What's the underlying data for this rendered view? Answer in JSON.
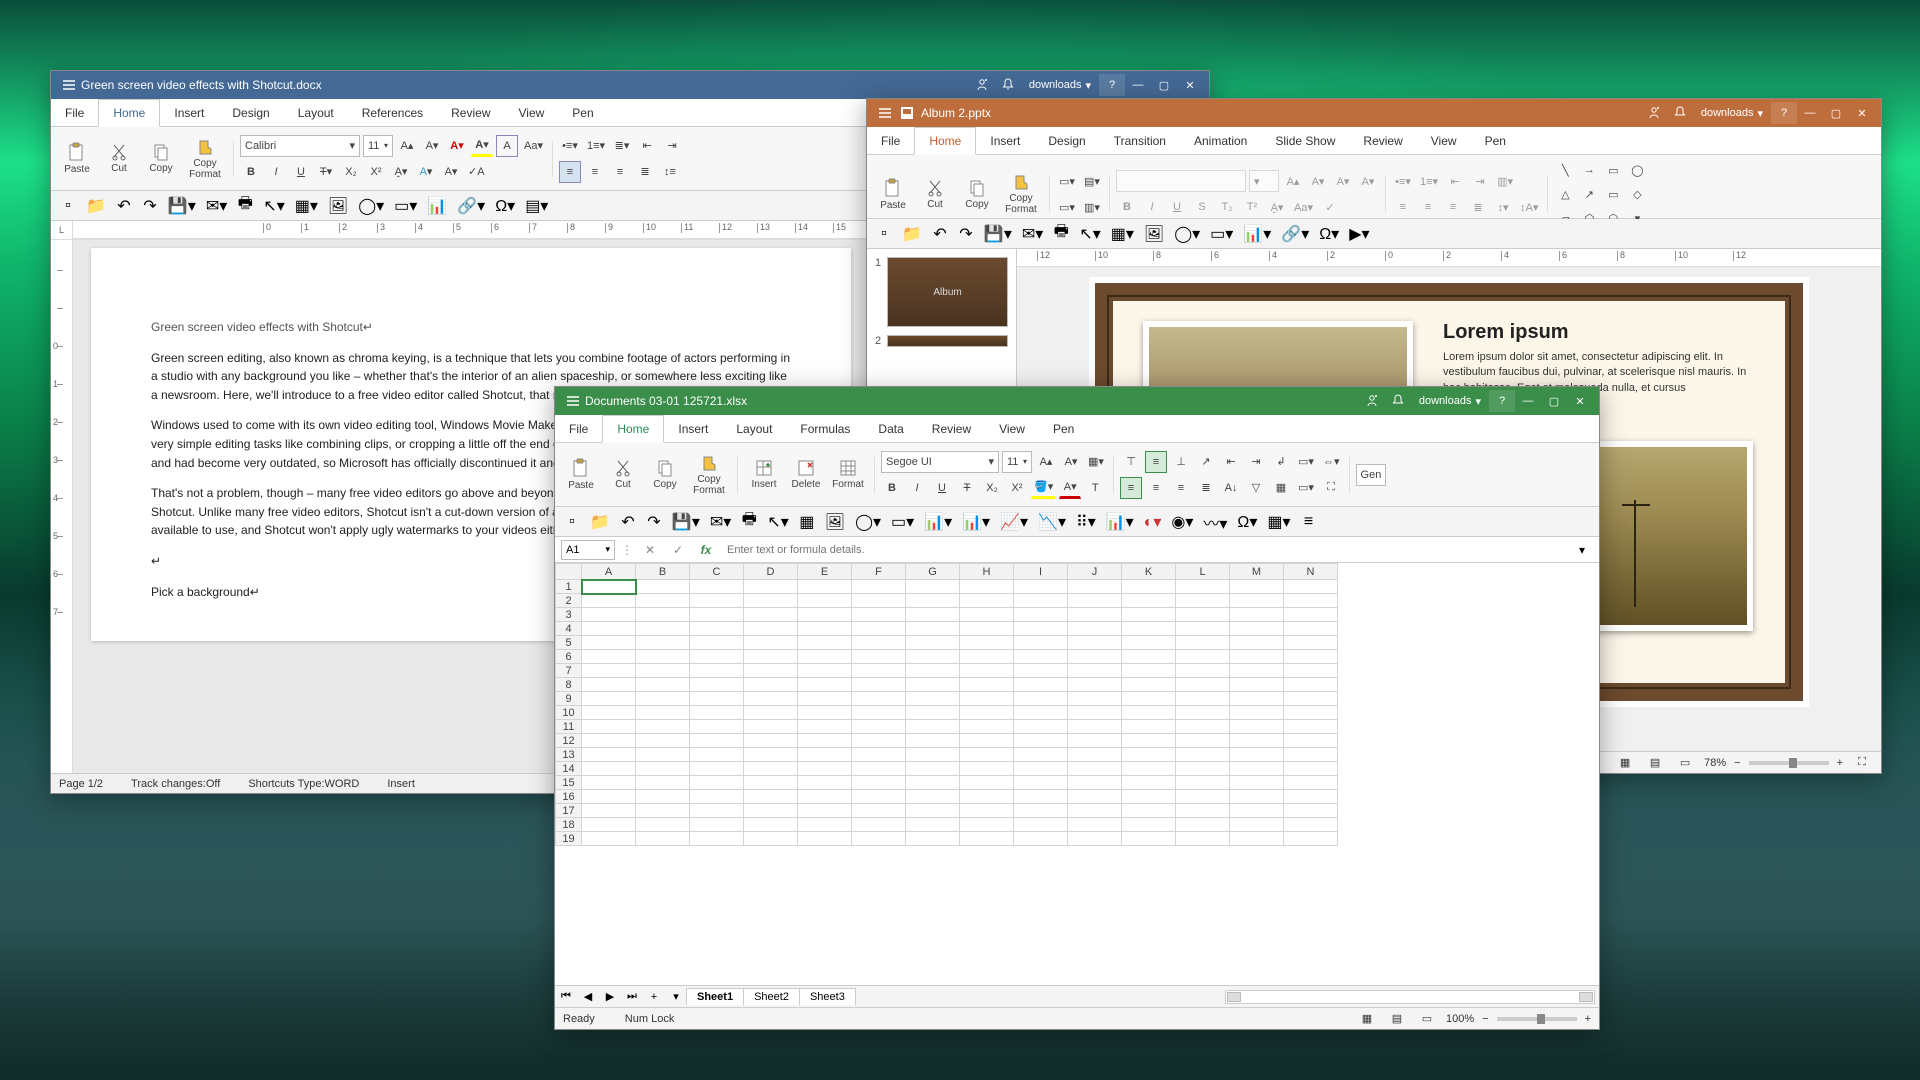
{
  "word": {
    "title": "Green screen video effects with Shotcut.docx",
    "downloads_label": "downloads",
    "tabs": [
      "File",
      "Home",
      "Insert",
      "Design",
      "Layout",
      "References",
      "Review",
      "View",
      "Pen"
    ],
    "active_tab": 1,
    "font_name": "Calibri",
    "font_size": "11",
    "clipboard": {
      "paste": "Paste",
      "cut": "Cut",
      "copy": "Copy",
      "copy_format": "Copy Format"
    },
    "ruler_corner": "L",
    "doc": {
      "h": "Green screen video effects with Shotcut↵",
      "p1": "Green screen editing, also known as chroma keying, is a technique that lets you combine footage of actors performing in a studio with any background you like – whether that's the interior of an alien spaceship, or somewhere less exciting like a newsroom. Here, we'll introduce to a free video editor called Shotcut, that makes using a green screen simple.↵",
      "p2": "Windows used to come with its own video editing tool, Windows Movie Maker, as standard. The program was great for very simple editing tasks like combining clips, or cropping a little off the end of a clip, but it was otherwise very limited and had become very outdated, so Microsoft has officially discontinued it and removed it from its site.↵",
      "p3": "That's not a problem, though – many free video editors go above and beyond Microsoft's offering, including the superb Shotcut. Unlike many free video editors, Shotcut isn't a cut-down version of a premium product; all the tools you see are available to use, and Shotcut won't apply ugly watermarks to your videos either. ↵",
      "blank": "↵",
      "h2": "Pick a background↵"
    },
    "status": {
      "page": "Page 1/2",
      "track": "Track changes:Off",
      "shortcuts": "Shortcuts Type:WORD",
      "insert": "Insert"
    }
  },
  "ppt": {
    "title": "Album 2.pptx",
    "downloads_label": "downloads",
    "tabs": [
      "File",
      "Home",
      "Insert",
      "Design",
      "Transition",
      "Animation",
      "Slide Show",
      "Review",
      "View",
      "Pen"
    ],
    "active_tab": 1,
    "font_size": "",
    "clipboard": {
      "paste": "Paste",
      "cut": "Cut",
      "copy": "Copy",
      "copy_format": "Copy Format"
    },
    "thumb_labels": [
      "1",
      "2"
    ],
    "thumb1_caption": "Album",
    "slide": {
      "heading": "Lorem ipsum",
      "body": "Lorem ipsum dolor sit amet, consectetur adipiscing elit. In vestibulum faucibus dui, pulvinar, at scelerisque nisl mauris. In hac habitasse. Eget et malesuada nulla, et cursus"
    },
    "zoom": "78%"
  },
  "xls": {
    "title": "Documents 03-01 125721.xlsx",
    "downloads_label": "downloads",
    "tabs": [
      "File",
      "Home",
      "Insert",
      "Layout",
      "Formulas",
      "Data",
      "Review",
      "View",
      "Pen"
    ],
    "active_tab": 1,
    "font_name": "Segoe UI",
    "font_size": "11",
    "clipboard": {
      "paste": "Paste",
      "cut": "Cut",
      "copy": "Copy",
      "copy_format": "Copy Format",
      "insert": "Insert",
      "delete": "Delete",
      "format": "Format"
    },
    "namebox": "A1",
    "formula_placeholder": "Enter text or formula details.",
    "numfmt": "Gen",
    "columns": [
      "A",
      "B",
      "C",
      "D",
      "E",
      "F",
      "G",
      "H",
      "I",
      "J",
      "K",
      "L",
      "M",
      "N"
    ],
    "rows": [
      1,
      2,
      3,
      4,
      5,
      6,
      7,
      8,
      9,
      10,
      11,
      12,
      13,
      14,
      15,
      16,
      17,
      18,
      19
    ],
    "selected_cell": "A1",
    "sheets": [
      "Sheet1",
      "Sheet2",
      "Sheet3"
    ],
    "active_sheet": 0,
    "status": {
      "ready": "Ready",
      "numlock": "Num Lock",
      "zoom": "100%"
    }
  }
}
